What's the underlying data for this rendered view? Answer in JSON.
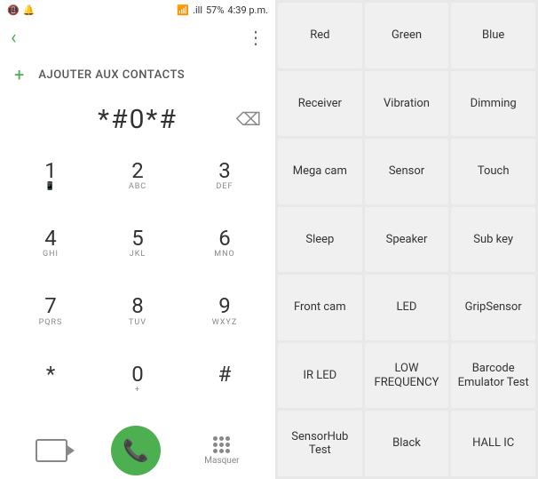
{
  "statusBar": {
    "icons": "📶",
    "signal": ".ill",
    "battery": "57%",
    "time": "4:39 p.m."
  },
  "topBar": {
    "backLabel": "‹",
    "moreLabel": "⋮"
  },
  "addContact": {
    "icon": "+",
    "label": "AJOUTER AUX CONTACTS"
  },
  "dialerNumber": "*#0*#",
  "keypad": [
    {
      "main": "1",
      "sub": ""
    },
    {
      "main": "2",
      "sub": "ABC"
    },
    {
      "main": "3",
      "sub": "DEF"
    },
    {
      "main": "4",
      "sub": "GHI"
    },
    {
      "main": "5",
      "sub": "JKL"
    },
    {
      "main": "6",
      "sub": "MNO"
    },
    {
      "main": "7",
      "sub": "PQRS"
    },
    {
      "main": "8",
      "sub": "TUV"
    },
    {
      "main": "9",
      "sub": "WXYZ"
    },
    {
      "main": "*",
      "sub": ""
    },
    {
      "main": "0",
      "sub": "+"
    },
    {
      "main": "#",
      "sub": ""
    }
  ],
  "bottomActions": {
    "masquerLabel": "Masquer"
  },
  "testButtons": [
    "Red",
    "Green",
    "Blue",
    "Receiver",
    "Vibration",
    "Dimming",
    "Mega cam",
    "Sensor",
    "Touch",
    "Sleep",
    "Speaker",
    "Sub key",
    "Front cam",
    "LED",
    "GripSensor",
    "IR LED",
    "LOW\nFREQUENCY",
    "Barcode\nEmulator\nTest",
    "SensorHub\nTest",
    "Black",
    "HALL IC"
  ]
}
